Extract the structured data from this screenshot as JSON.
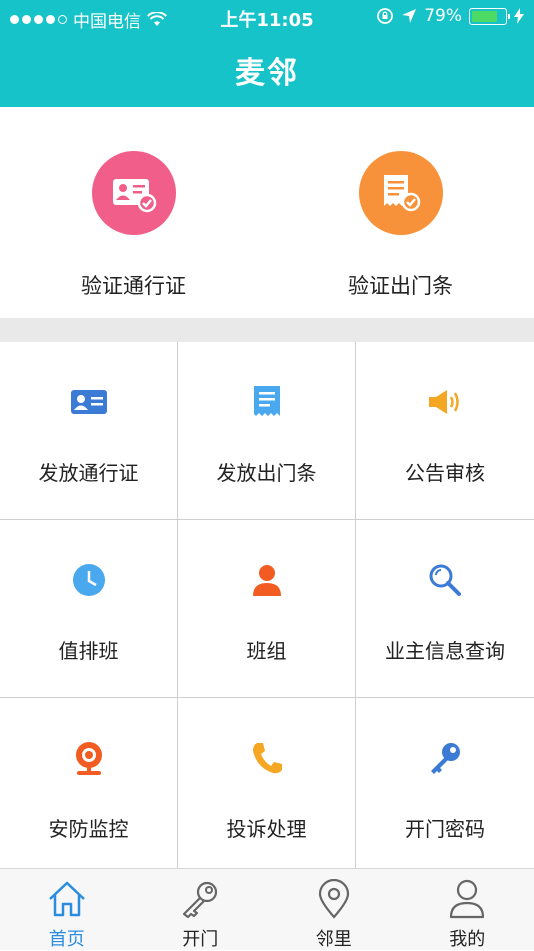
{
  "status_bar": {
    "carrier": "中国电信",
    "time": "上午11:05",
    "battery_percent": "79%",
    "battery_level": 0.79
  },
  "header": {
    "title": "麦邻"
  },
  "quick_actions": [
    {
      "label": "验证通行证",
      "icon": "id-card-check-icon",
      "color": "#f25e8a"
    },
    {
      "label": "验证出门条",
      "icon": "receipt-check-icon",
      "color": "#f7923a"
    }
  ],
  "grid": [
    {
      "label": "发放通行证",
      "icon": "id-card-icon"
    },
    {
      "label": "发放出门条",
      "icon": "receipt-icon"
    },
    {
      "label": "公告审核",
      "icon": "megaphone-icon"
    },
    {
      "label": "值排班",
      "icon": "clock-icon"
    },
    {
      "label": "班组",
      "icon": "person-icon"
    },
    {
      "label": "业主信息查询",
      "icon": "search-icon"
    },
    {
      "label": "安防监控",
      "icon": "camera-icon"
    },
    {
      "label": "投诉处理",
      "icon": "phone-icon"
    },
    {
      "label": "开门密码",
      "icon": "key-icon"
    }
  ],
  "tabbar": [
    {
      "label": "首页",
      "icon": "home-icon",
      "active": true
    },
    {
      "label": "开门",
      "icon": "key-outline-icon",
      "active": false
    },
    {
      "label": "邻里",
      "icon": "location-pin-icon",
      "active": false
    },
    {
      "label": "我的",
      "icon": "user-icon",
      "active": false
    }
  ],
  "colors": {
    "brand": "#16c3c8",
    "active_tab": "#2a8de0"
  }
}
